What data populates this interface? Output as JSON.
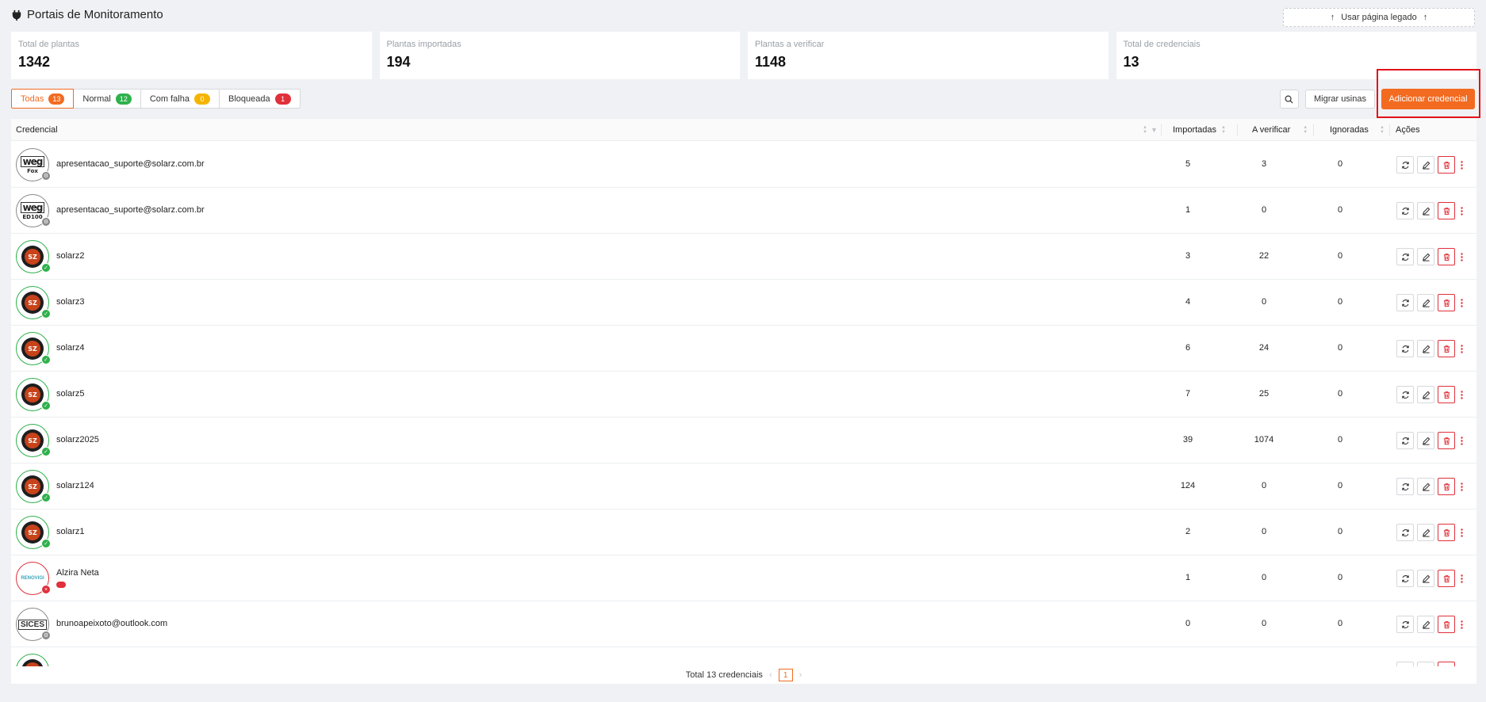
{
  "header": {
    "title": "Portais de Monitoramento",
    "legacy_button": "Usar página legado"
  },
  "stats": [
    {
      "label": "Total de plantas",
      "value": "1342"
    },
    {
      "label": "Plantas importadas",
      "value": "194"
    },
    {
      "label": "Plantas a verificar",
      "value": "1148"
    },
    {
      "label": "Total de credenciais",
      "value": "13"
    }
  ],
  "filters": [
    {
      "label": "Todas",
      "count": "13",
      "color": "#f26b21",
      "active": true
    },
    {
      "label": "Normal",
      "count": "12",
      "color": "#2eb14b",
      "active": false
    },
    {
      "label": "Com falha",
      "count": "0",
      "color": "#f5b400",
      "active": false
    },
    {
      "label": "Bloqueada",
      "count": "1",
      "color": "#e0303a",
      "active": false
    }
  ],
  "toolbar": {
    "migrate_label": "Migrar usinas",
    "add_label": "Adicionar credencial"
  },
  "table": {
    "columns": {
      "credential": "Credencial",
      "imported": "Importadas",
      "to_verify": "A verificar",
      "ignored": "Ignoradas",
      "actions": "Ações"
    },
    "rows": [
      {
        "logo": "weg",
        "logo_sub": "Fox",
        "status": "gray",
        "credential": "apresentacao_suporte@solarz.com.br",
        "imported": "5",
        "to_verify": "3",
        "ignored": "0"
      },
      {
        "logo": "weg",
        "logo_sub": "ED100",
        "status": "gray",
        "credential": "apresentacao_suporte@solarz.com.br",
        "imported": "1",
        "to_verify": "0",
        "ignored": "0"
      },
      {
        "logo": "sz",
        "logo_sub": "SZ",
        "status": "ok",
        "credential": "solarz2",
        "imported": "3",
        "to_verify": "22",
        "ignored": "0"
      },
      {
        "logo": "sz",
        "logo_sub": "SZ",
        "status": "ok",
        "credential": "solarz3",
        "imported": "4",
        "to_verify": "0",
        "ignored": "0"
      },
      {
        "logo": "sz",
        "logo_sub": "SZ",
        "status": "ok",
        "credential": "solarz4",
        "imported": "6",
        "to_verify": "24",
        "ignored": "0"
      },
      {
        "logo": "sz",
        "logo_sub": "SZ",
        "status": "ok",
        "credential": "solarz5",
        "imported": "7",
        "to_verify": "25",
        "ignored": "0"
      },
      {
        "logo": "sz",
        "logo_sub": "SZ",
        "status": "ok",
        "credential": "solarz2025",
        "imported": "39",
        "to_verify": "1074",
        "ignored": "0"
      },
      {
        "logo": "sz",
        "logo_sub": "SZ",
        "status": "ok",
        "credential": "solarz124",
        "imported": "124",
        "to_verify": "0",
        "ignored": "0"
      },
      {
        "logo": "sz",
        "logo_sub": "SZ",
        "status": "ok",
        "credential": "solarz1",
        "imported": "2",
        "to_verify": "0",
        "ignored": "0"
      },
      {
        "logo": "renovigi",
        "logo_sub": "RENOVIGI",
        "status": "err",
        "credential": "Alzira Neta",
        "imported": "1",
        "to_verify": "0",
        "ignored": "0"
      },
      {
        "logo": "sices",
        "logo_sub": "SICES",
        "status": "gray",
        "credential": "brunoapeixoto@outlook.com",
        "imported": "0",
        "to_verify": "0",
        "ignored": "0"
      },
      {
        "logo": "sz",
        "logo_sub": "",
        "status": "ok",
        "credential": "",
        "imported": "",
        "to_verify": "",
        "ignored": ""
      }
    ]
  },
  "pagination": {
    "total_label": "Total 13 credenciais",
    "current_page": "1"
  }
}
